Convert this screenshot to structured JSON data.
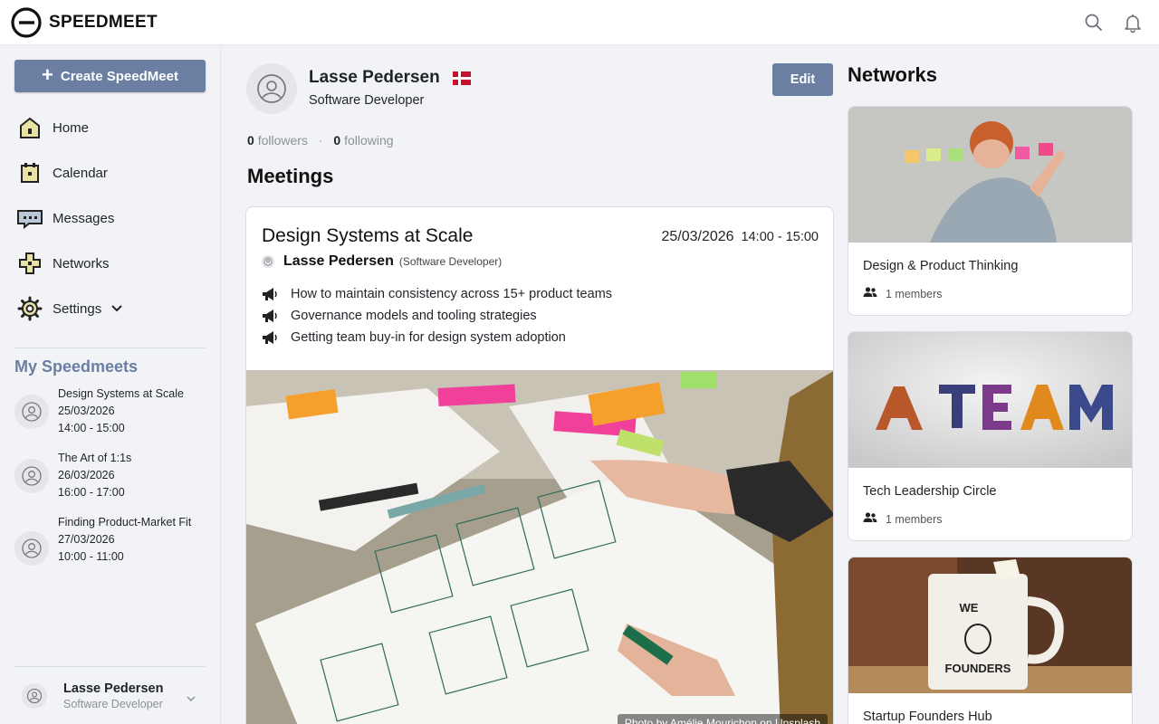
{
  "app": {
    "brand": "SPEEDMEET"
  },
  "sidebar": {
    "create_label": "Create SpeedMeet",
    "nav": [
      {
        "label": "Home",
        "icon": "home-icon"
      },
      {
        "label": "Calendar",
        "icon": "calendar-icon"
      },
      {
        "label": "Messages",
        "icon": "messages-icon"
      },
      {
        "label": "Networks",
        "icon": "networks-icon"
      },
      {
        "label": "Settings",
        "icon": "gear-icon"
      }
    ],
    "my_title": "My Speedmeets",
    "my_items": [
      {
        "title": "Design Systems at Scale",
        "date": "25/03/2026",
        "time": "14:00 - 15:00"
      },
      {
        "title": "The Art of 1:1s",
        "date": "26/03/2026",
        "time": "16:00 - 17:00"
      },
      {
        "title": "Finding Product-Market Fit",
        "date": "27/03/2026",
        "time": "10:00 - 11:00"
      }
    ],
    "user": {
      "name": "Lasse Pedersen",
      "role": "Software Developer"
    }
  },
  "profile": {
    "name": "Lasse Pedersen",
    "role": "Software Developer",
    "edit_label": "Edit",
    "followers_count": "0",
    "followers_label": "followers",
    "following_count": "0",
    "following_label": "following"
  },
  "meetings": {
    "title": "Meetings",
    "card": {
      "title": "Design Systems at Scale",
      "date": "25/03/2026",
      "time": "14:00 - 15:00",
      "host_name": "Lasse Pedersen",
      "host_role": "(Software Developer)",
      "topics": [
        "How to maintain consistency across 15+ product teams",
        "Governance models and tooling strategies",
        "Getting team buy-in for design system adoption"
      ],
      "photo_credit": "Photo by Amélie Mourichon on Unsplash"
    }
  },
  "networks": {
    "title": "Networks",
    "items": [
      {
        "name": "Design & Product Thinking",
        "members": "1 members"
      },
      {
        "name": "Tech Leadership Circle",
        "members": "1 members"
      },
      {
        "name": "Startup Founders Hub",
        "members": ""
      }
    ]
  },
  "colors": {
    "accent": "#6b7fa3",
    "flag_red": "#c8102e"
  }
}
